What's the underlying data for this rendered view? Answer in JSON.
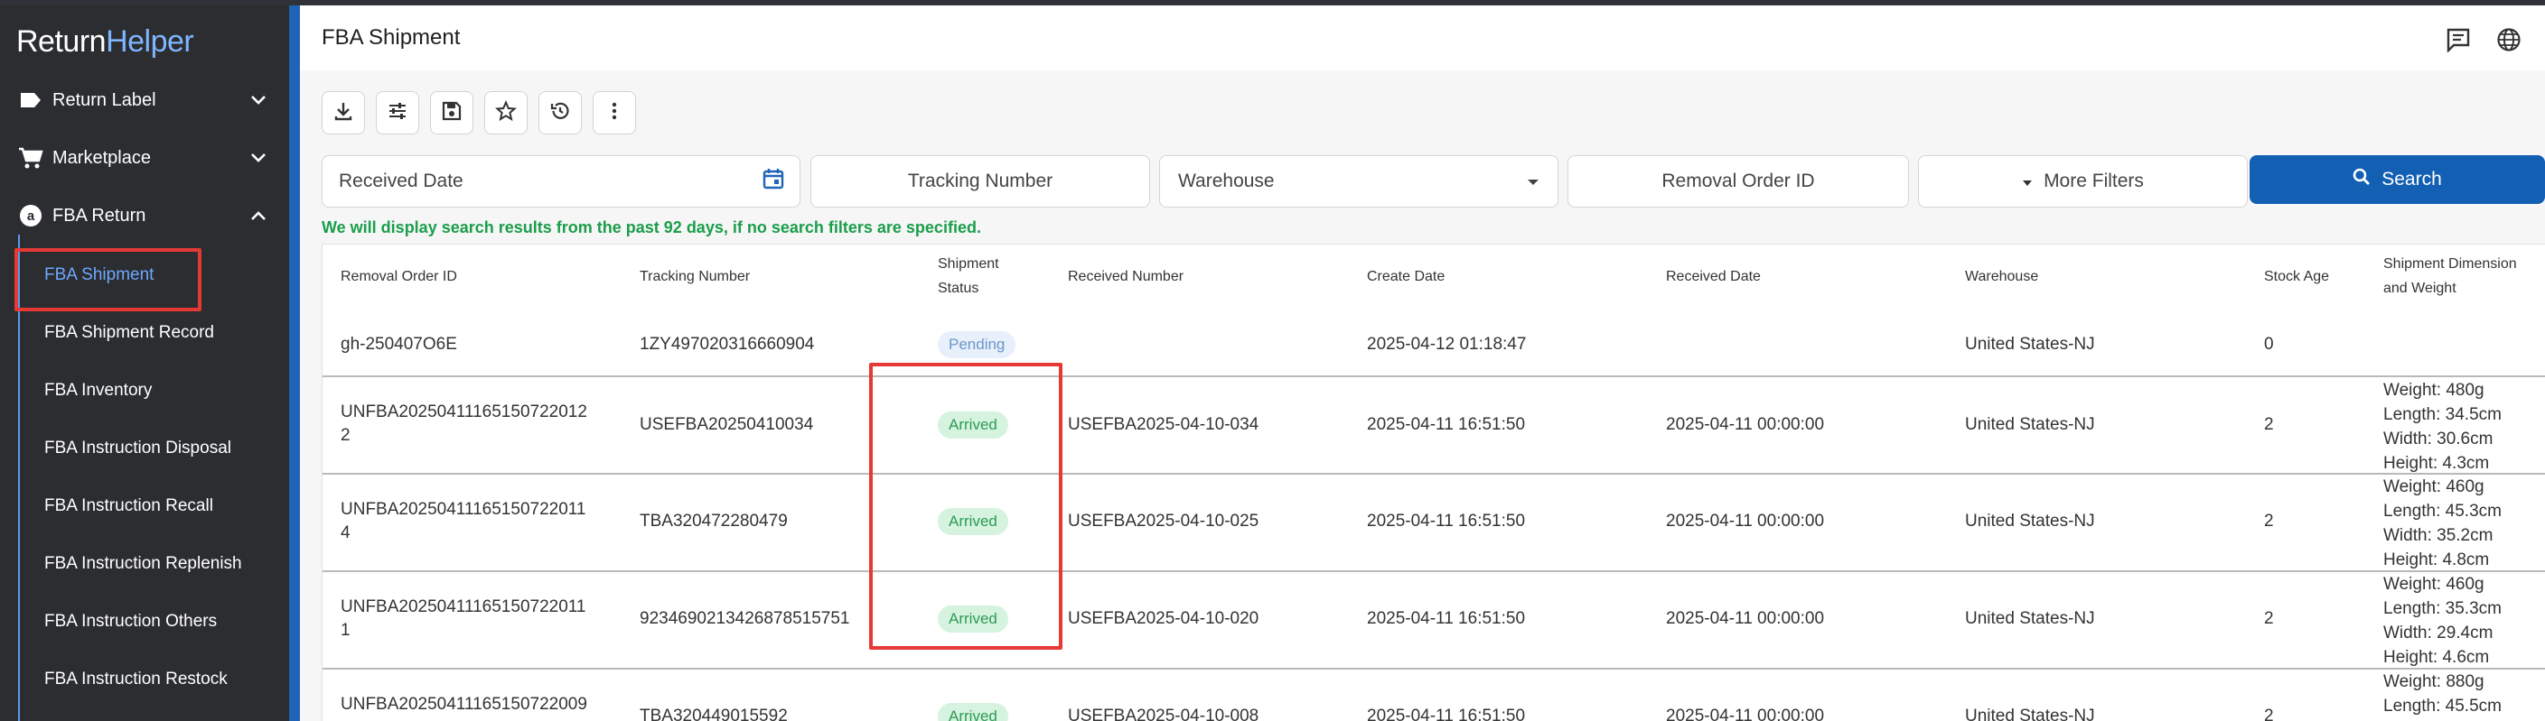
{
  "app": {
    "logo_prefix": "Return",
    "logo_suffix": "Helper"
  },
  "sidebar": {
    "menus": [
      {
        "label": "Return Label",
        "icon": "label-icon",
        "expanded": false
      },
      {
        "label": "Marketplace",
        "icon": "cart-icon",
        "expanded": false
      },
      {
        "label": "FBA Return",
        "icon": "amazon-icon",
        "expanded": true
      }
    ],
    "fba_items": [
      {
        "label": "FBA Shipment",
        "active": true
      },
      {
        "label": "FBA Shipment Record",
        "active": false
      },
      {
        "label": "FBA Inventory",
        "active": false
      },
      {
        "label": "FBA Instruction Disposal",
        "active": false
      },
      {
        "label": "FBA Instruction Recall",
        "active": false
      },
      {
        "label": "FBA Instruction Replenish",
        "active": false
      },
      {
        "label": "FBA Instruction Others",
        "active": false
      },
      {
        "label": "FBA Instruction Restock",
        "active": false
      }
    ]
  },
  "header": {
    "title": "FBA Shipment",
    "icons": [
      "message-icon",
      "globe-icon"
    ]
  },
  "toolbar": {
    "buttons": [
      "download-icon",
      "tune-icon",
      "save-icon",
      "star-icon",
      "history-icon",
      "more-vert-icon"
    ]
  },
  "filters": {
    "received_date_placeholder": "Received Date",
    "tracking_number_label": "Tracking Number",
    "warehouse_placeholder": "Warehouse",
    "removal_order_id_label": "Removal Order ID",
    "more_filters_label": "More Filters",
    "search_label": "Search"
  },
  "hint": "We will display search results from the past 92 days, if no search filters are specified.",
  "table": {
    "headers": {
      "removal_order_id": "Removal Order ID",
      "tracking_number": "Tracking Number",
      "shipment_status_1": "Shipment",
      "shipment_status_2": "Status",
      "received_number": "Received Number",
      "create_date": "Create Date",
      "received_date": "Received Date",
      "warehouse": "Warehouse",
      "stock_age": "Stock Age",
      "dimension_1": "Shipment Dimension",
      "dimension_2": "and Weight"
    },
    "rows": [
      {
        "removal_order_id_1": "gh-250407O6E",
        "removal_order_id_2": "",
        "tracking_number": "1ZY497020316660904",
        "status": "Pending",
        "received_number": "",
        "create_date": "2025-04-12 01:18:47",
        "received_date": "",
        "warehouse": "United States-NJ",
        "stock_age": "0",
        "dims": []
      },
      {
        "removal_order_id_1": "UNFBA20250411165150722012",
        "removal_order_id_2": "2",
        "tracking_number": "USEFBA20250410034",
        "status": "Arrived",
        "received_number": "USEFBA2025-04-10-034",
        "create_date": "2025-04-11 16:51:50",
        "received_date": "2025-04-11 00:00:00",
        "warehouse": "United States-NJ",
        "stock_age": "2",
        "dims": [
          "Weight: 480g",
          "Length: 34.5cm",
          "Width: 30.6cm",
          "Height: 4.3cm"
        ]
      },
      {
        "removal_order_id_1": "UNFBA20250411165150722011",
        "removal_order_id_2": "4",
        "tracking_number": "TBA320472280479",
        "status": "Arrived",
        "received_number": "USEFBA2025-04-10-025",
        "create_date": "2025-04-11 16:51:50",
        "received_date": "2025-04-11 00:00:00",
        "warehouse": "United States-NJ",
        "stock_age": "2",
        "dims": [
          "Weight: 460g",
          "Length: 45.3cm",
          "Width: 35.2cm",
          "Height: 4.8cm"
        ]
      },
      {
        "removal_order_id_1": "UNFBA20250411165150722011",
        "removal_order_id_2": "1",
        "tracking_number": "9234690213426878515751",
        "status": "Arrived",
        "received_number": "USEFBA2025-04-10-020",
        "create_date": "2025-04-11 16:51:50",
        "received_date": "2025-04-11 00:00:00",
        "warehouse": "United States-NJ",
        "stock_age": "2",
        "dims": [
          "Weight: 460g",
          "Length: 35.3cm",
          "Width: 29.4cm",
          "Height: 4.6cm"
        ]
      },
      {
        "removal_order_id_1": "UNFBA20250411165150722009",
        "removal_order_id_2": "",
        "tracking_number": "TBA320449015592",
        "status": "Arrived",
        "received_number": "USEFBA2025-04-10-008",
        "create_date": "2025-04-11 16:51:50",
        "received_date": "2025-04-11 00:00:00",
        "warehouse": "United States-NJ",
        "stock_age": "2",
        "dims": [
          "Weight: 880g",
          "Length: 45.5cm"
        ]
      }
    ]
  },
  "colors": {
    "sidebar_bg": "#2b2d30",
    "accent": "#135fb3",
    "active_item": "#6ea8ff",
    "hint_green": "#1a9e4a",
    "highlight_red": "#e53935"
  }
}
